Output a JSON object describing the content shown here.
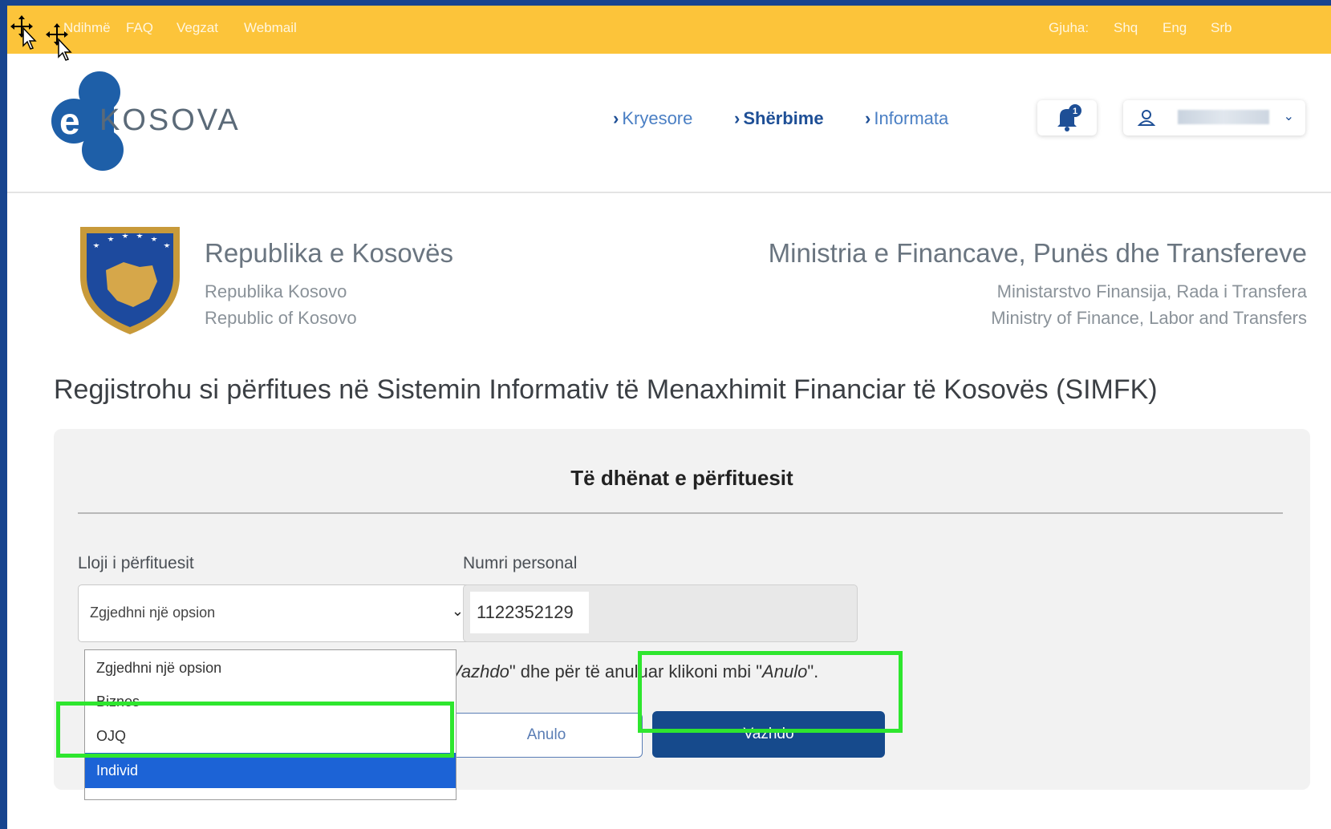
{
  "topbar": {
    "links": [
      "Ndihmë",
      "FAQ",
      "Vegzat",
      "Webmail"
    ],
    "language_label": "Gjuha:",
    "languages": [
      "Shq",
      "Eng",
      "Srb"
    ]
  },
  "header": {
    "logo_letter": "e",
    "logo_text": "KOSOVA",
    "nav": [
      "Kryesore",
      "Shërbime",
      "Informata"
    ],
    "active_nav": "Shërbime",
    "notification_count": "1",
    "user_name": ""
  },
  "gov": {
    "left": [
      "Republika e Kosovës",
      "Republika Kosovo",
      "Republic of Kosovo"
    ],
    "right": [
      "Ministria e Financave, Punës dhe Transfereve",
      "Ministarstvo Finansija, Rada i Transfera",
      "Ministry of Finance, Labor and Transfers"
    ]
  },
  "page_title": "Regjistrohu si përfitues në Sistemin Informativ të Menaxhimit Financiar të Kosovës (SIMFK)",
  "form": {
    "section_title": "Të dhënat e përfituesit",
    "type_label": "Lloji i përfituesit",
    "type_select_value": "Zgjedhni një opsion",
    "type_options": [
      "Zgjedhni një opsion",
      "Biznes",
      "OJQ",
      "Individ"
    ],
    "highlighted_option": "Individ",
    "personal_number_label": "Numri personal",
    "personal_number_value": "1122352129",
    "hint_prefix": "Vazhdo",
    "hint_middle": "\" dhe për të anuluar klikoni mbi \"",
    "hint_anulo": "Anulo",
    "hint_suffix": "\".",
    "cancel_label": "Anulo",
    "continue_label": "Vazhdo"
  },
  "colors": {
    "topbar": "#fcc43a",
    "brand_blue": "#164a8c",
    "highlight_green": "#2ee62e",
    "selected_option": "#1c63d6"
  }
}
